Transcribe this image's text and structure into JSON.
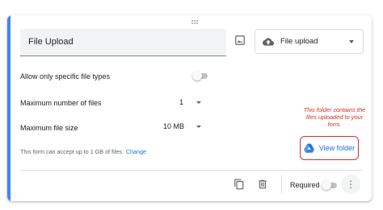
{
  "question": {
    "title": "File Upload",
    "type_label": "File upload"
  },
  "settings": {
    "specific_types_label": "Allow only specific file types",
    "max_files_label": "Maximum number of files",
    "max_files_value": "1",
    "max_size_label": "Maximum file size",
    "max_size_value": "10 MB",
    "info_text": "This form can accept up to 1 GB of files.",
    "change_label": "Change"
  },
  "annotation": {
    "text": "This folder contains the files uploaded to your form."
  },
  "folder_button": {
    "label": "View folder"
  },
  "footer": {
    "required_label": "Required",
    "more_glyph": "⋮"
  },
  "colors": {
    "accent": "#4285f4",
    "link": "#1a73e8",
    "annotation": "#d93025"
  },
  "icons": {
    "drag": "drag-handle-icon",
    "image": "image-icon",
    "type": "cloud-upload-icon",
    "drive": "google-drive-icon",
    "duplicate": "duplicate-icon",
    "delete": "trash-icon",
    "more": "more-vert-icon"
  }
}
